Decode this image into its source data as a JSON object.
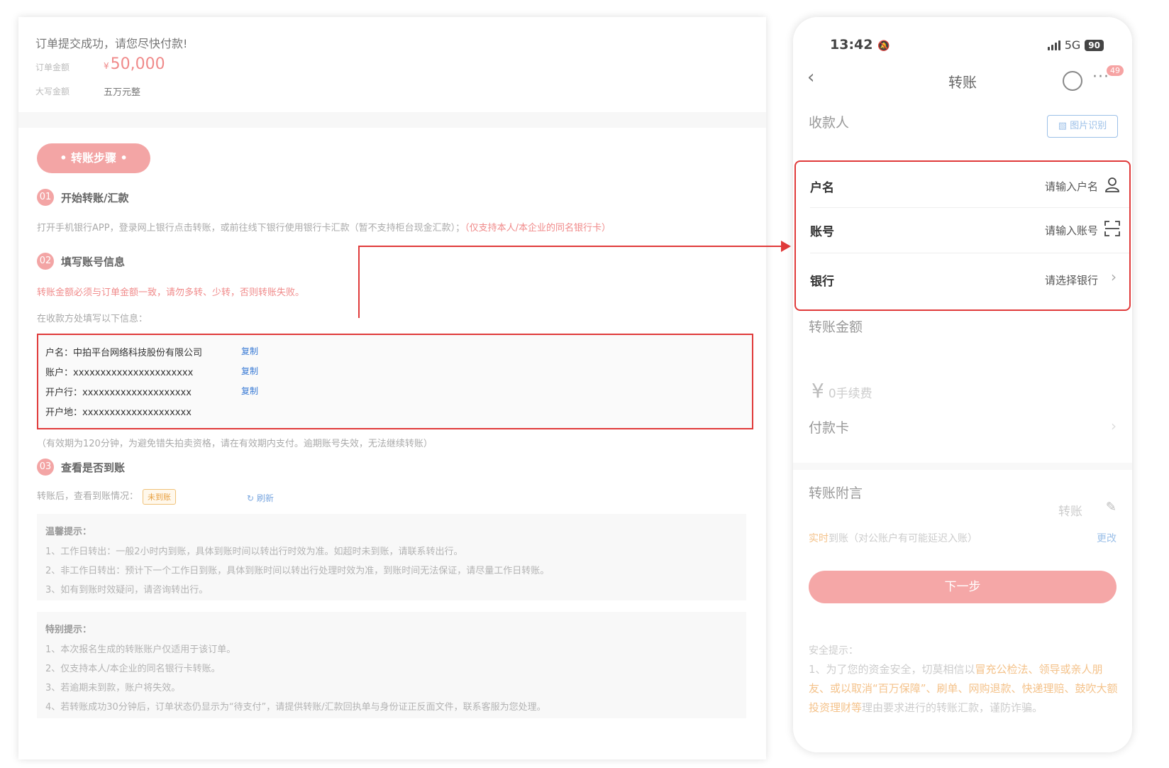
{
  "order": {
    "success_msg": "订单提交成功，请您尽快付款!",
    "amount_label": "订单金额",
    "currency_symbol": "¥",
    "amount_value": "50,000",
    "capital_label": "大写金额",
    "capital_value": "五万元整"
  },
  "steps": {
    "pill_label": "• 转账步骤 •",
    "step1": {
      "num": "01",
      "title": "开始转账/汇款",
      "text": "打开手机银行APP，登录网上银行点击转账，或前往线下银行使用银行卡汇款（暂不支持柜台现金汇款）；",
      "note": "（仅支持本人/本企业的同名银行卡）"
    },
    "step2": {
      "num": "02",
      "title": "填写账号信息",
      "warning": "转账金额必须与订单金额一致，请勿多转、少转，否则转账失败。",
      "instruction": "在收款方处填写以下信息：",
      "rows": [
        {
          "label": "户名：",
          "value": "中拍平台网络科技股份有限公司",
          "copy": "复制"
        },
        {
          "label": "账户：",
          "value": "xxxxxxxxxxxxxxxxxxxxxx",
          "copy": "复制"
        },
        {
          "label": "开户行：",
          "value": "xxxxxxxxxxxxxxxxxxxx",
          "copy": "复制"
        },
        {
          "label": "开户地：",
          "value": "xxxxxxxxxxxxxxxxxxxx"
        }
      ],
      "validity": "（有效期为120分钟，为避免错失拍卖资格，请在有效期内支付。逾期账号失效，无法继续转账）"
    },
    "step3": {
      "num": "03",
      "title": "查看是否到账",
      "check_text": "转账后，查看到账情况：",
      "status": "未到账",
      "refresh": "刷新"
    }
  },
  "tips": {
    "warm_title": "温馨提示：",
    "warm_lines": [
      "1、工作日转出：一般2小时内到账，具体到账时间以转出行时效为准。如超时未到账，请联系转出行。",
      "2、非工作日转出：预计下一个工作日到账，具体到账时间以转出行处理时效为准，到账时间无法保证，请尽量工作日转账。",
      "3、如有到账时效疑问，请咨询转出行。"
    ],
    "special_title": "特别提示：",
    "special_lines": [
      "1、本次报名生成的转账账户仅适用于该订单。",
      "2、仅支持本人/本企业的同名银行卡转账。",
      "3、若逾期未到款，账户将失效。",
      "4、若转账成功30分钟后，订单状态仍显示为“待支付”，请提供转账/汇款回执单与身份证正反面文件，联系客服为您处理。"
    ]
  },
  "phone": {
    "status_time": "13:42",
    "network": "5G",
    "battery": "90",
    "nav_title": "转账",
    "badge": "49",
    "payee_label": "收款人",
    "img_recog": "图片识别",
    "fields": [
      {
        "label": "户名",
        "placeholder": "请输入户名"
      },
      {
        "label": "账号",
        "placeholder": "请输入账号"
      },
      {
        "label": "银行",
        "placeholder": "请选择银行"
      }
    ],
    "amount_label": "转账金额",
    "yen": "¥",
    "fee_placeholder": "0手续费",
    "pay_card_label": "付款卡",
    "remark_label": "转账附言",
    "remark_value": "转账",
    "realtime_hl": "实时",
    "realtime_rest": "到账（对公账户有可能延迟入账）",
    "change": "更改",
    "next_btn": "下一步",
    "safety_title": "安全提示：",
    "safety_parts": [
      "1、为了您的资金安全，切莫相信以",
      "冒充公检法、领导或亲人朋友、或以取消“百万保障”、刷单、网购退款、快递理赔、鼓吹大额投资理财等",
      "理由要求进行的转账汇款，谨防诈骗。"
    ]
  },
  "colors": {
    "accent_pink": "#f3a5a5",
    "highlight_red": "#e03a3a",
    "link_blue": "#3a7bd5"
  }
}
